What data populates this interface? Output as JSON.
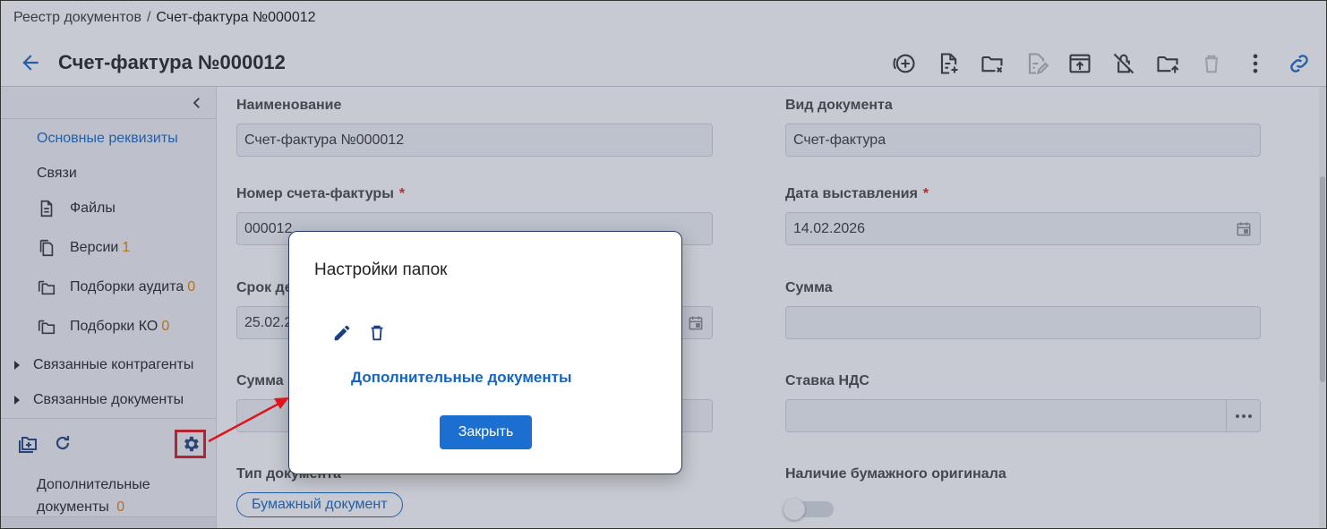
{
  "breadcrumb": {
    "root": "Реестр документов",
    "separator": "/",
    "current": "Счет-фактура №000012"
  },
  "header": {
    "title": "Счет-фактура №000012"
  },
  "toolbar": {
    "icons": [
      "add-circle-icon",
      "add-file-icon",
      "remove-folder-icon",
      "edit-file-icon",
      "upload-icon",
      "unlock-icon",
      "move-folder-icon",
      "delete-icon",
      "more-icon",
      "link-icon"
    ]
  },
  "sidebar": {
    "items": [
      {
        "label": "Основные реквизиты"
      },
      {
        "label": "Связи"
      },
      {
        "label": "Файлы"
      },
      {
        "label": "Версии",
        "count": "1"
      },
      {
        "label": "Подборки аудита",
        "count": "0"
      },
      {
        "label": "Подборки КО",
        "count": "0"
      },
      {
        "label": "Связанные контрагенты"
      },
      {
        "label": "Связанные документы"
      }
    ],
    "folder": {
      "label": "Дополнительные документы",
      "count": "0"
    }
  },
  "form": {
    "name_label": "Наименование",
    "name_value": "Счет-фактура №000012",
    "doc_type_label": "Вид документа",
    "doc_type_value": "Счет-фактура",
    "invoice_number_label": "Номер счета-фактуры",
    "invoice_number_value": "000012",
    "issue_date_label": "Дата выставления",
    "issue_date_value": "14.02.2026",
    "deadline_label": "Срок де",
    "deadline_value": "25.02.2",
    "sum_label": "Сумма",
    "sum_value": "",
    "sum2_label": "Сумма",
    "vat_label": "Ставка НДС",
    "vat_value": "",
    "doc_kind_label": "Тип документа",
    "doc_kind_chip": "Бумажный документ",
    "paper_original_label": "Наличие бумажного оригинала",
    "required_mark": "*"
  },
  "modal": {
    "title": "Настройки папок",
    "folder_name": "Дополнительные документы",
    "close_label": "Закрыть"
  },
  "colors": {
    "accent": "#1565c0",
    "button": "#1a6fd1",
    "count": "#e67e00",
    "highlight": "#e0121a"
  }
}
